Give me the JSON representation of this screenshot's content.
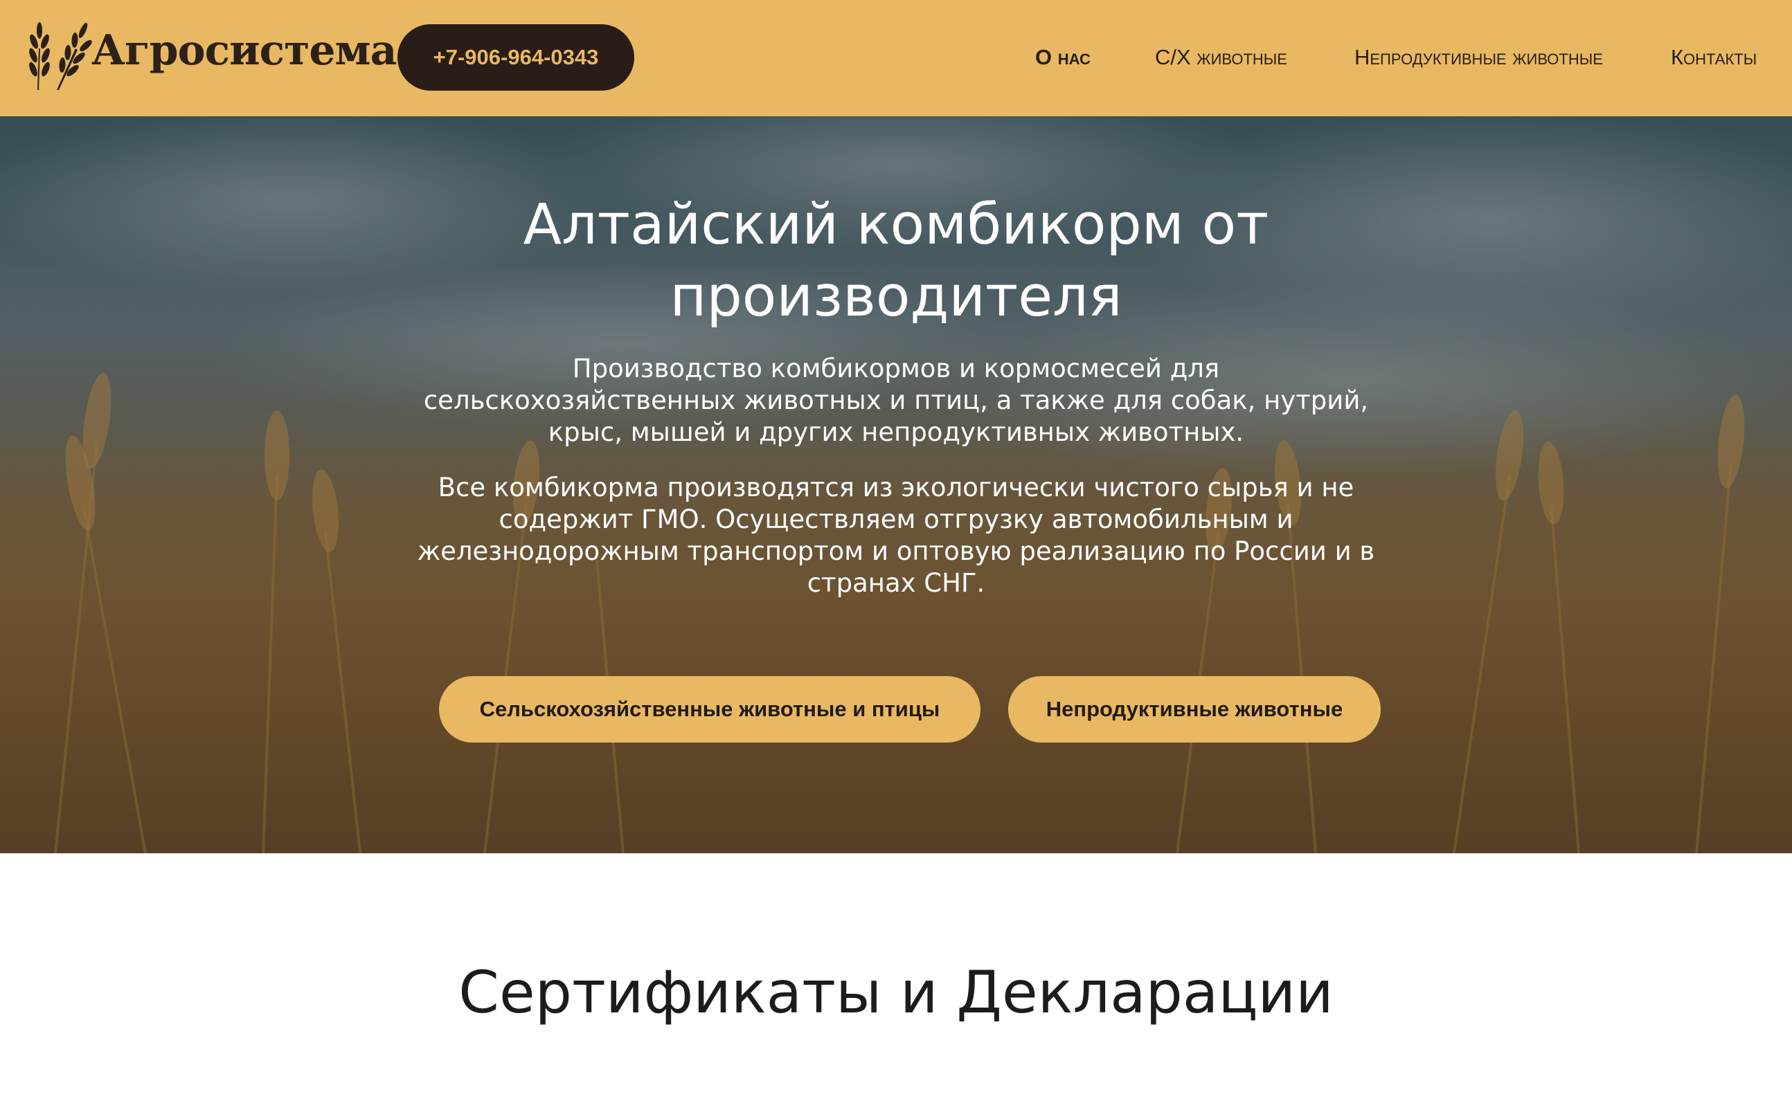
{
  "header": {
    "logo_text": "Агросистема",
    "logo_icon": "wheat-icon",
    "phone": "+7-906-964-0343",
    "nav": [
      {
        "label": "О нас"
      },
      {
        "label": "С/Х животные"
      },
      {
        "label": "Непродуктивные животные"
      },
      {
        "label": "Контакты"
      }
    ]
  },
  "hero": {
    "title_line1": "Алтайский комбикорм от",
    "title_line2": "производителя",
    "para1_lines": [
      "Производство комбикормов и кормосмесей для",
      "сельскохозяйственных животных и птиц, а также для собак, нутрий,",
      "крыс, мышей и других непродуктивных животных."
    ],
    "para2_lines": [
      "Все комбикорма производятся из экологически чистого сырья и не",
      "содержит ГМО. Осуществляем отгрузку автомобильным и",
      "железнодорожным транспортом и оптовую реализацию по России и в",
      "странах СНГ."
    ],
    "button_farm": "Сельскохозяйственные животные и птицы",
    "button_pets": "Непродуктивные животные"
  },
  "certificates": {
    "title": "Сертификаты и Декларации"
  },
  "colors": {
    "header_bg": "#e8b962",
    "dark_brown": "#2a1d17",
    "accent_gold": "#e8b962",
    "hero_text": "#ffffff"
  }
}
